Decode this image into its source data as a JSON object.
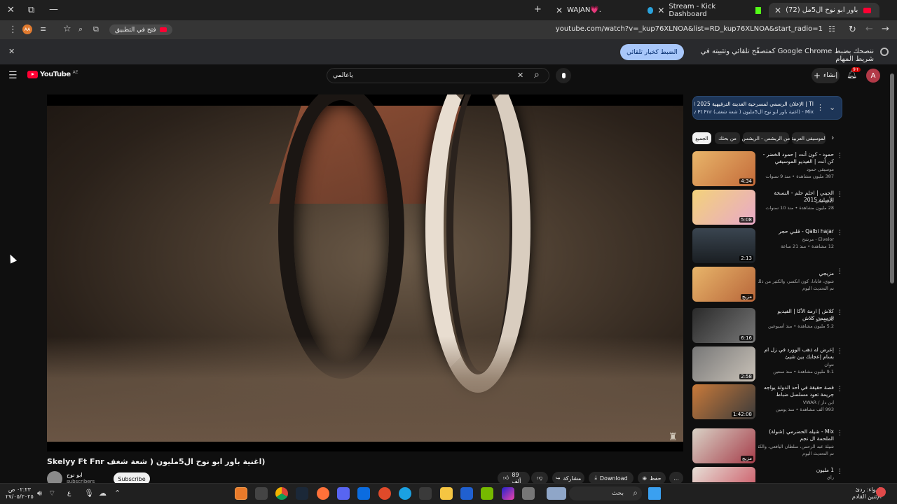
{
  "browser": {
    "tabs": [
      {
        "title": "WAJAN💗.",
        "active": false
      },
      {
        "title": "Stream - Kick Dashboard",
        "active": false
      },
      {
        "title": "(72) اغنية باور ابو نوح ال5مل...",
        "active": true
      }
    ],
    "url": "youtube.com/watch?v=_kup76XLNOA&list=RD_kup76XLNOA&start_radio=1",
    "open_in_app": "فتح في التطبيق",
    "profile_initials": "AA"
  },
  "infobar": {
    "text": "ننصحك بضبط Google Chrome كمتصفّح تلقائي وتثبيته في شريط المهام",
    "button": "الضبط كخيار تلقائي"
  },
  "youtube": {
    "logo": "YouTube",
    "logo_suffix": "AE",
    "search_value": "ياعالمي",
    "create_label": "إنشاء",
    "notifications": "9+",
    "avatar_letter": "A"
  },
  "video": {
    "title": "(اغنية باور ابو نوح ال5مليون ( شعة شغف Skelyy Ft Fnr",
    "channel": "ابو نوح",
    "subscribers": "subscribers",
    "subscribe": "Subscribe",
    "likes": "89 ألف",
    "share": "مشاركة",
    "download": "Download",
    "save": "حفظ",
    "more": "..."
  },
  "playlist": {
    "title": "TI | الإعلان الرسمي لمسرحية العدينة الترفيهية 2025 التالي...",
    "subtitle": "Mix - (اغنية باور ابو نوح ال5مليون ( شعة شغف) Skelyy Ft Fnr"
  },
  "chips": [
    "الجميع",
    "من بحثك",
    "من الريشس - الريشس",
    "الموسيقى العربية"
  ],
  "recommendations": [
    {
      "title": "حمود - كون أنت | حمود الخضر - كن أنت | الفيديو الموسيقي الرسمي",
      "channel": "موسيقى حمود",
      "meta": "387 مليون مشاهدة • منذ 9 سنوات",
      "duration": "4:34"
    },
    {
      "title": "الجيني | احلم حلم - النسخة الأصلية 2015",
      "channel": "جيني نيني",
      "meta": "28 مليون مشاهدة • منذ 10 سنوات",
      "duration": "5:08"
    },
    {
      "title": "Qalbi hajar - قلبي حجر",
      "channel": "Elvelor - مرشح",
      "meta": "12 مشاهدة • منذ 21 ساعة",
      "duration": "2:13"
    },
    {
      "title": "مزيجي",
      "channel": "شوي، فابادا، كون انكسر، والكثير من ذلك",
      "meta": "تم التحديث اليوم",
      "duration": "مزيج"
    },
    {
      "title": "كلاش | ارمة الأكا | الفيديو الرسمي كلاش",
      "channel": "كلاش فلو",
      "meta": "5.2 مليون مشاهدة • منذ أسبوعين",
      "duration": "6:16"
    },
    {
      "title": "إعرض له ذهب الوورد في زل ام بسام إعجابك بين شيئ",
      "channel": "نتوان",
      "meta": "9.1 مليون مشاهدة • منذ سنتين",
      "duration": "2:58"
    },
    {
      "title": "قصة حقيقة في أحد الدولة يواجه جريمة تعود مسلسل ضباط التحريات",
      "channel": "ابن دار / VWAR",
      "meta": "993 ألف مشاهدة • منذ يومين",
      "duration": "1:42:08"
    },
    {
      "title": "Mix - شيله الحضرمي (شولة) الملحمة ال نجم",
      "channel": "شيلة عبد الرحمن، سلطان اليافعي، والكثير",
      "meta": "تم التحديث اليوم",
      "duration": "مزيج"
    },
    {
      "title": "1 مليون",
      "channel": "راي",
      "meta": "",
      "duration": ""
    }
  ],
  "taskbar": {
    "search": "بحث",
    "time": "٠٢:٢٣ ص",
    "date": "٢٧/٠٥/٢٠٢٥",
    "weather": "الهواء: ردئ",
    "weather_sub": "الإثنين القادم",
    "lang": "ع"
  }
}
